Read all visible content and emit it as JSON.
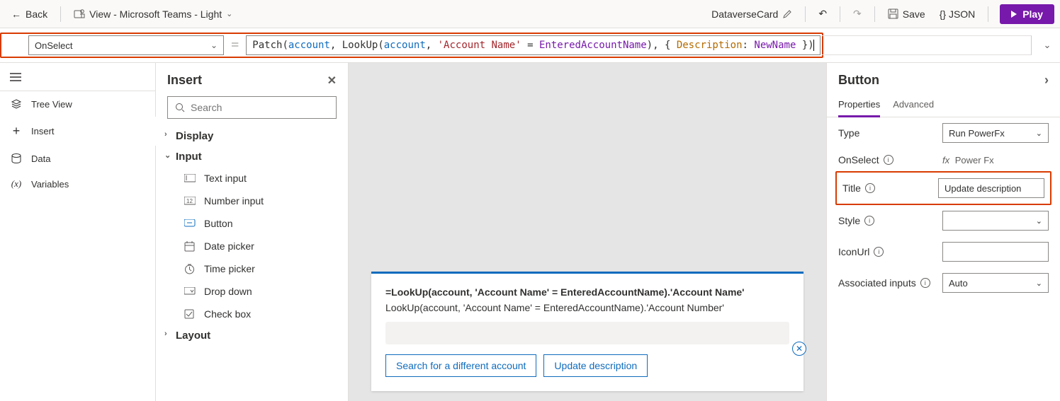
{
  "toolbar": {
    "back": "Back",
    "view_label": "View - Microsoft Teams - Light",
    "card_name": "DataverseCard",
    "save": "Save",
    "json": "{} JSON",
    "play": "Play"
  },
  "formula": {
    "property": "OnSelect",
    "tokens": [
      "Patch",
      "(",
      "account",
      ", LookUp(",
      "account",
      ", ",
      "'Account Name'",
      " = ",
      "EnteredAccountName",
      "), { ",
      "Description",
      ": ",
      "NewName",
      " })"
    ]
  },
  "left_rail": {
    "items": [
      {
        "label": "Tree View"
      },
      {
        "label": "Insert"
      },
      {
        "label": "Data"
      },
      {
        "label": "Variables"
      }
    ]
  },
  "insert": {
    "title": "Insert",
    "search_placeholder": "Search",
    "categories": [
      {
        "label": "Display",
        "expanded": false,
        "items": []
      },
      {
        "label": "Input",
        "expanded": true,
        "items": [
          {
            "label": "Text input"
          },
          {
            "label": "Number input"
          },
          {
            "label": "Button"
          },
          {
            "label": "Date picker"
          },
          {
            "label": "Time picker"
          },
          {
            "label": "Drop down"
          },
          {
            "label": "Check box"
          }
        ]
      },
      {
        "label": "Layout",
        "expanded": false,
        "items": []
      }
    ]
  },
  "canvas": {
    "line1": "=LookUp(account, 'Account Name' = EnteredAccountName).'Account Name'",
    "line2": "LookUp(account, 'Account Name' = EnteredAccountName).'Account Number'",
    "btn1": "Search for a different account",
    "btn2": "Update description"
  },
  "props": {
    "title": "Button",
    "tabs": [
      "Properties",
      "Advanced"
    ],
    "rows": {
      "type_label": "Type",
      "type_value": "Run PowerFx",
      "onselect_label": "OnSelect",
      "onselect_value": "Power Fx",
      "title_label": "Title",
      "title_value": "Update description",
      "style_label": "Style",
      "style_value": "",
      "iconurl_label": "IconUrl",
      "iconurl_value": "",
      "assoc_label": "Associated inputs",
      "assoc_value": "Auto"
    }
  }
}
